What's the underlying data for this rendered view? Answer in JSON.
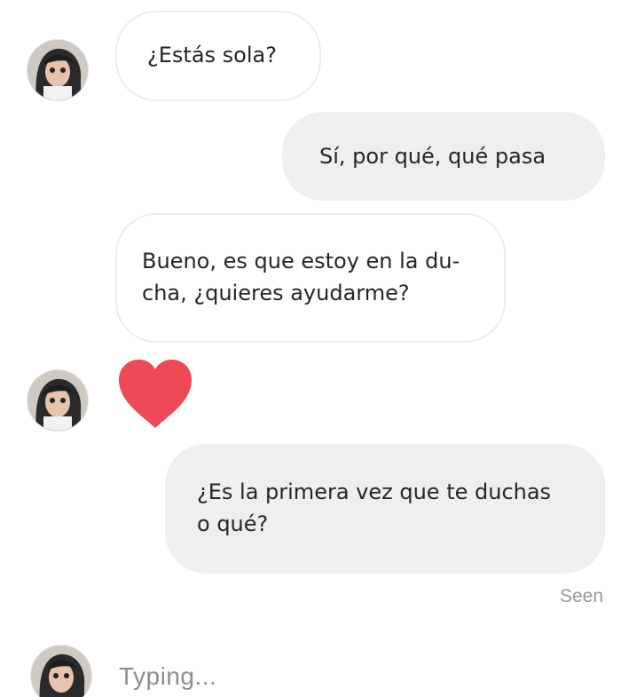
{
  "messages": [
    {
      "sender": "contact",
      "text": "¿Estás sola?"
    },
    {
      "sender": "me",
      "text": "Sí, por qué, qué pasa"
    },
    {
      "sender": "contact",
      "line1": "Bueno, es que estoy en la du-",
      "line2": "cha, ¿quieres ayudarme?"
    },
    {
      "sender": "contact",
      "reaction": "heart-icon"
    },
    {
      "sender": "me",
      "line1": "¿Es la primera vez que te duchas",
      "line2": "o qué?"
    }
  ],
  "status": {
    "seen": "Seen",
    "typing": "Typing..."
  },
  "colors": {
    "heart": "#ed4956",
    "outgoing_bubble": "#efefef",
    "incoming_border": "#ececec",
    "meta_text": "#999999"
  }
}
